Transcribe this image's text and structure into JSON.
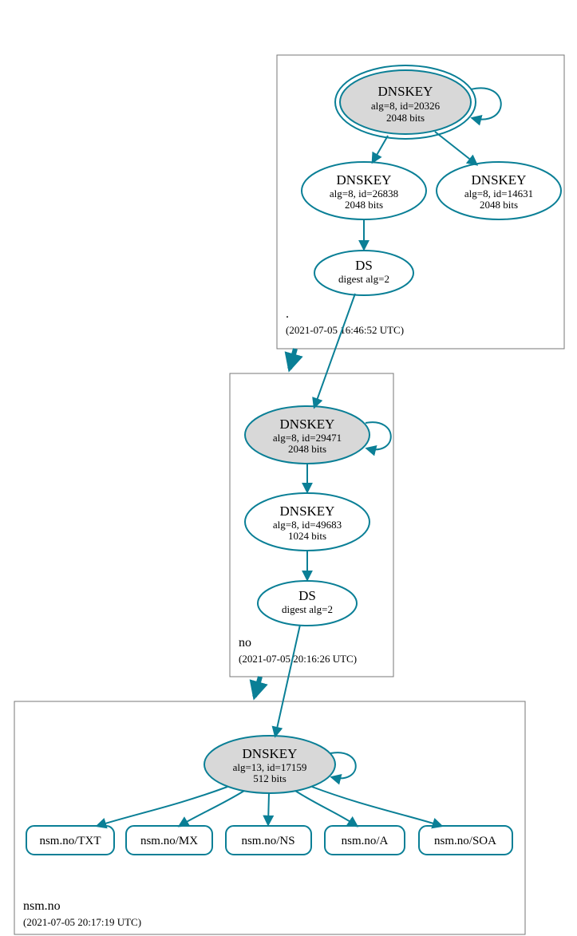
{
  "colors": {
    "stroke": "#0a7f96",
    "box": "#777777",
    "shaded": "#d8d8d8"
  },
  "zones": {
    "root": {
      "label": ".",
      "time": "(2021-07-05 16:46:52 UTC)"
    },
    "no": {
      "label": "no",
      "time": "(2021-07-05 20:16:26 UTC)"
    },
    "nsm": {
      "label": "nsm.no",
      "time": "(2021-07-05 20:17:19 UTC)"
    }
  },
  "nodes": {
    "root_ksk": {
      "title": "DNSKEY",
      "sub1": "alg=8, id=20326",
      "sub2": "2048 bits"
    },
    "root_k2": {
      "title": "DNSKEY",
      "sub1": "alg=8, id=26838",
      "sub2": "2048 bits"
    },
    "root_k3": {
      "title": "DNSKEY",
      "sub1": "alg=8, id=14631",
      "sub2": "2048 bits"
    },
    "root_ds": {
      "title": "DS",
      "sub1": "digest alg=2"
    },
    "no_ksk": {
      "title": "DNSKEY",
      "sub1": "alg=8, id=29471",
      "sub2": "2048 bits"
    },
    "no_k2": {
      "title": "DNSKEY",
      "sub1": "alg=8, id=49683",
      "sub2": "1024 bits"
    },
    "no_ds": {
      "title": "DS",
      "sub1": "digest alg=2"
    },
    "nsm_ksk": {
      "title": "DNSKEY",
      "sub1": "alg=13, id=17159",
      "sub2": "512 bits"
    },
    "rr_txt": {
      "title": "nsm.no/TXT"
    },
    "rr_mx": {
      "title": "nsm.no/MX"
    },
    "rr_ns": {
      "title": "nsm.no/NS"
    },
    "rr_a": {
      "title": "nsm.no/A"
    },
    "rr_soa": {
      "title": "nsm.no/SOA"
    }
  }
}
